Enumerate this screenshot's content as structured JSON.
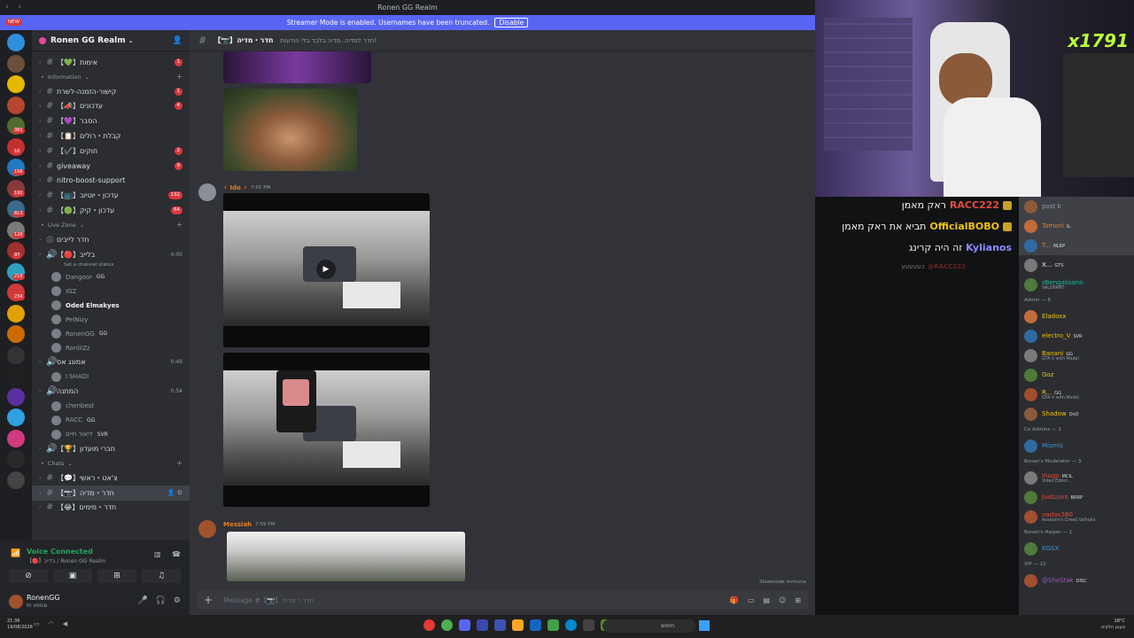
{
  "window": {
    "title": "Ronen GG Realm",
    "streamer_banner": "Streamer Mode is enabled. Usernames have been truncated.",
    "disable_label": "Disable"
  },
  "guilds": {
    "new_label": "NEW",
    "badges": [
      "381",
      "10",
      "156",
      "192",
      "813",
      "120",
      "97",
      "218",
      "234"
    ]
  },
  "server": {
    "name": "Ronen GG Realm"
  },
  "channels": {
    "top": [
      {
        "name": "【💚】אימות",
        "unread": "1"
      }
    ],
    "information_label": "Information",
    "information": [
      {
        "name": "קישור-הזמנה-לשרת",
        "unread": "1"
      },
      {
        "name": "【📣】עדכונים",
        "unread": "4"
      },
      {
        "name": "【💜】הסבר",
        "unread": ""
      },
      {
        "name": "【📋】קבלת・רולים",
        "unread": ""
      },
      {
        "name": "【✔️】חוקים",
        "unread": "2"
      },
      {
        "name": "giveaway",
        "unread": "9"
      },
      {
        "name": "nitro-boost-support",
        "unread": ""
      },
      {
        "name": "【📺】עדכון・יוטיוב",
        "unread": "132"
      },
      {
        "name": "【🟢】עדכון・קיק",
        "unread": "64"
      }
    ],
    "live_zone_label": "Live Zone",
    "live_zone": {
      "stage": "חדר לייבים",
      "voice_channel": "【🔴】בלייב",
      "voice_time": "4:00",
      "status_hint": "Set a channel status",
      "users": [
        {
          "name": "Dangoor",
          "tag": "GG"
        },
        {
          "name": "IGZ",
          "tag": ""
        },
        {
          "name": "Oded Elmakyes",
          "tag": ""
        },
        {
          "name": "PelNizy",
          "tag": ""
        },
        {
          "name": "RonenGG",
          "tag": "GG"
        },
        {
          "name": "RonliiZz",
          "tag": ""
        }
      ],
      "voice2": "אמונג אס",
      "voice2_time": "0:49",
      "voice2_users": [
        {
          "name": "I SHADI",
          "tag": ""
        }
      ],
      "voice3": "המתנה",
      "voice3_time": "0:54",
      "voice3_users": [
        {
          "name": "chenbest",
          "tag": ""
        },
        {
          "name": "RACC",
          "tag": "GG"
        },
        {
          "name": "ליאור חיים",
          "tag": "SVR"
        }
      ],
      "voice4": "【🏆】חברי מועדון"
    },
    "chats_label": "Chats",
    "chats": [
      {
        "name": "【💬】צ'אט・ראשי"
      },
      {
        "name": "【📷】חדר・מדיה"
      },
      {
        "name": "【😂】חדר・מימים"
      }
    ]
  },
  "voice": {
    "status": "Voice Connected",
    "sub": "【🔴】בלייב / Ronen GG Realm"
  },
  "user": {
    "name": "RonenGG",
    "status": "In voice"
  },
  "main": {
    "channel_title": "【📷】חדר・מדיה",
    "topic": "חדר למדיה. מדיה בלבד בלי הודעות!",
    "messages": [
      {
        "author": "⚡ Ido ⚡",
        "time": "7:01 PM",
        "color": "#e67e22"
      },
      {
        "author": "Messiah",
        "time": "7:59 PM",
        "color": "#e67e22"
      }
    ],
    "composer_placeholder": "Message #【📷】חדר・מדיה",
    "slowmode": "Slowmode immune"
  },
  "members": {
    "groups": [
      {
        "label": "",
        "items": [
          {
            "name": "post b",
            "tag": "",
            "sub": "",
            "color": "#949ba4"
          },
          {
            "name": "Tamoni",
            "tag": "IL",
            "sub": "",
            "color": "#e67e22"
          },
          {
            "name": "T...",
            "tag": "NLRP",
            "sub": "",
            "color": "#e67e22"
          },
          {
            "name": "X...",
            "tag": "GTS",
            "sub": "",
            "color": "#f2f3f5"
          },
          {
            "name": "zBengalisonn",
            "tag": "",
            "sub": "VALORANT",
            "color": "#1abc9c"
          }
        ]
      },
      {
        "label": "Admin — 6",
        "items": [
          {
            "name": "Eladoxx",
            "tag": "",
            "sub": "",
            "color": "#f1c40f"
          },
          {
            "name": "electro_V",
            "tag": "SVR",
            "sub": "",
            "color": "#f1c40f"
          },
          {
            "name": "Banani",
            "tag": "GG",
            "sub": "GTA V with Medal",
            "color": "#f1c40f"
          },
          {
            "name": "Goz",
            "tag": "",
            "sub": "",
            "color": "#f1c40f"
          },
          {
            "name": "R...",
            "tag": "GG",
            "sub": "GTA V with Medal",
            "color": "#f1c40f"
          },
          {
            "name": "Shadow",
            "tag": "OvO",
            "sub": "",
            "color": "#f1c40f"
          }
        ]
      },
      {
        "label": "Co Admins — 1",
        "items": [
          {
            "name": "Mismis",
            "tag": "",
            "sub": "",
            "color": "#3498db"
          }
        ]
      },
      {
        "label": "Ronen's Moderator — 3",
        "items": [
          {
            "name": "Inugo",
            "tag": "MCIL",
            "sub": "Video Editor...",
            "color": "#e74c3c"
          },
          {
            "name": "JustLiors",
            "tag": "BRRP",
            "sub": "",
            "color": "#e74c3c"
          },
          {
            "name": "nadav380",
            "tag": "",
            "sub": "Assassin's Creed Valhalla",
            "color": "#e74c3c"
          }
        ]
      },
      {
        "label": "Ronen's Helper — 1",
        "items": [
          {
            "name": "KGSX",
            "tag": "",
            "sub": "",
            "color": "#3498db"
          }
        ]
      },
      {
        "label": "VIP — 10",
        "items": [
          {
            "name": "@ShoStak",
            "tag": "DISC",
            "sub": "",
            "color": "#9b59b6"
          }
        ]
      }
    ]
  },
  "stream_chat": [
    {
      "user": "RACC222",
      "text": "ראק מאמן",
      "color": "#e74c3c"
    },
    {
      "user": "OfficialBOBO",
      "text": "תביא את ראק מאמן",
      "color": "#f1c40f"
    },
    {
      "user": "Kylianos",
      "text": "זה היה קרינג",
      "color": "#8b8bff"
    },
    {
      "user": "@RACC222",
      "text": "כעעעעע",
      "color": "#da373c"
    }
  ],
  "webcam": {
    "overlay_text": "x1791"
  },
  "taskbar": {
    "time": "21:36",
    "date": "19/08/2026",
    "search": "חיפוש",
    "weather": "28°C",
    "weather_sub": "מעונן חלקית"
  },
  "colors": {
    "brand": "#5865f2",
    "online": "#23a55a",
    "mention": "#da373c"
  }
}
